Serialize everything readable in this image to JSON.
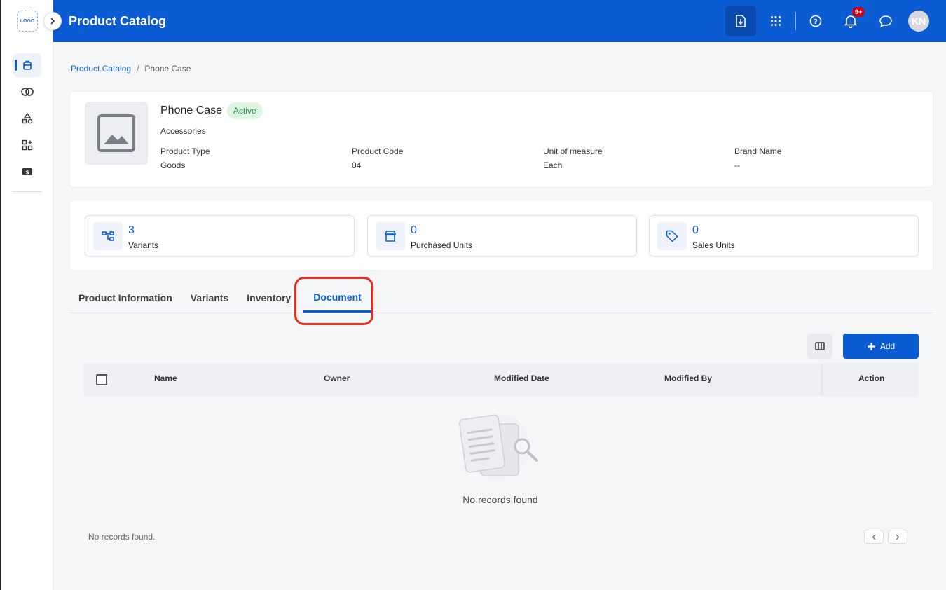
{
  "app": {
    "title": "Product Catalog",
    "logo_text": "LOGO",
    "avatar_initials": "KN",
    "notification_count": "9+"
  },
  "sidebar": {
    "items": [
      {
        "icon": "catalog-icon",
        "active": true
      },
      {
        "icon": "rings-icon",
        "active": false
      },
      {
        "icon": "shapes-icon",
        "active": false
      },
      {
        "icon": "grid-add-icon",
        "active": false
      },
      {
        "icon": "cash-icon",
        "active": false
      }
    ]
  },
  "breadcrumb": {
    "root": "Product Catalog",
    "separator": "/",
    "current": "Phone Case"
  },
  "product": {
    "name": "Phone Case",
    "status": "Active",
    "category": "Accessories",
    "attributes": [
      {
        "label": "Product Type",
        "value": "Goods"
      },
      {
        "label": "Product Code",
        "value": "04"
      },
      {
        "label": "Unit of measure",
        "value": "Each"
      },
      {
        "label": "Brand Name",
        "value": "--"
      }
    ]
  },
  "stats": [
    {
      "value": "3",
      "label": "Variants",
      "icon": "hierarchy-icon"
    },
    {
      "value": "0",
      "label": "Purchased Units",
      "icon": "store-icon"
    },
    {
      "value": "0",
      "label": "Sales Units",
      "icon": "tag-icon"
    }
  ],
  "tabs": [
    {
      "label": "Product Information",
      "active": false
    },
    {
      "label": "Variants",
      "active": false
    },
    {
      "label": "Inventory",
      "active": false
    },
    {
      "label": "Document",
      "active": true
    }
  ],
  "toolbar": {
    "add_label": "Add"
  },
  "table": {
    "columns": [
      "Name",
      "Owner",
      "Modified Date",
      "Modified By",
      "Action"
    ],
    "empty_message": "No records found",
    "footer_message": "No records found."
  },
  "colors": {
    "primary": "#0b5bd3",
    "highlight": "#e8301f",
    "active_green": "#1f8a3b"
  }
}
